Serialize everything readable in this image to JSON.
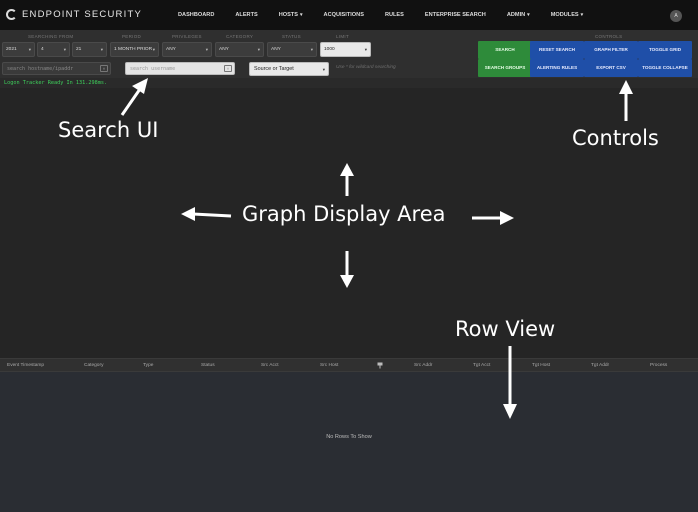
{
  "nav": {
    "brand": "ENDPOINT SECURITY",
    "items": [
      {
        "label": "DASHBOARD",
        "dropdown": false
      },
      {
        "label": "ALERTS",
        "dropdown": false
      },
      {
        "label": "HOSTS",
        "dropdown": true
      },
      {
        "label": "ACQUISITIONS",
        "dropdown": false
      },
      {
        "label": "RULES",
        "dropdown": false
      },
      {
        "label": "ENTERPRISE SEARCH",
        "dropdown": false
      },
      {
        "label": "ADMIN",
        "dropdown": true
      },
      {
        "label": "MODULES",
        "dropdown": true
      }
    ],
    "avatar": "A"
  },
  "search": {
    "labels": [
      "SEARCHING FROM",
      "PERIOD",
      "PRIVILEGES",
      "CATEGORY",
      "STATUS",
      "LIMIT"
    ],
    "year": "2021",
    "month": "4",
    "day": "21",
    "period": "1 MONTH PRIOR",
    "privileges": "ANY",
    "category": "ANY",
    "status": "ANY",
    "limit": "1000",
    "host_placeholder": "search hostname/ipaddr",
    "user_placeholder": "search username",
    "direction": "Source or Target",
    "hint": "Use * for wildcard searching"
  },
  "controls": {
    "label": "CONTROLS",
    "search": "SEARCH",
    "reset_search": "RESET SEARCH",
    "graph_filter": "GRAPH FILTER",
    "toggle_grid": "TOGGLE GRID",
    "search_groups": "SEARCH GROUPS",
    "alerting_rules": "ALERTING RULES",
    "export_csv": "EXPORT CSV",
    "toggle_collapse": "TOGGLE COLLAPSE"
  },
  "status_text": "Logon Tracker Ready In 131.298ms.",
  "table": {
    "columns": [
      "Event Timestamp",
      "Category",
      "Type",
      "Status",
      "Src Acct",
      "Src Host",
      "Src Addr",
      "Tgt Acct",
      "Tgt Host",
      "Tgt Addr",
      "Process"
    ],
    "empty": "No Rows To Show"
  },
  "annotations": {
    "search_ui": "Search UI",
    "controls": "Controls",
    "graph_area": "Graph Display Area",
    "row_view": "Row View"
  },
  "icons": {
    "brand": "endpoint-logo-icon",
    "pin": "pin-icon",
    "clear": "clear-icon"
  }
}
